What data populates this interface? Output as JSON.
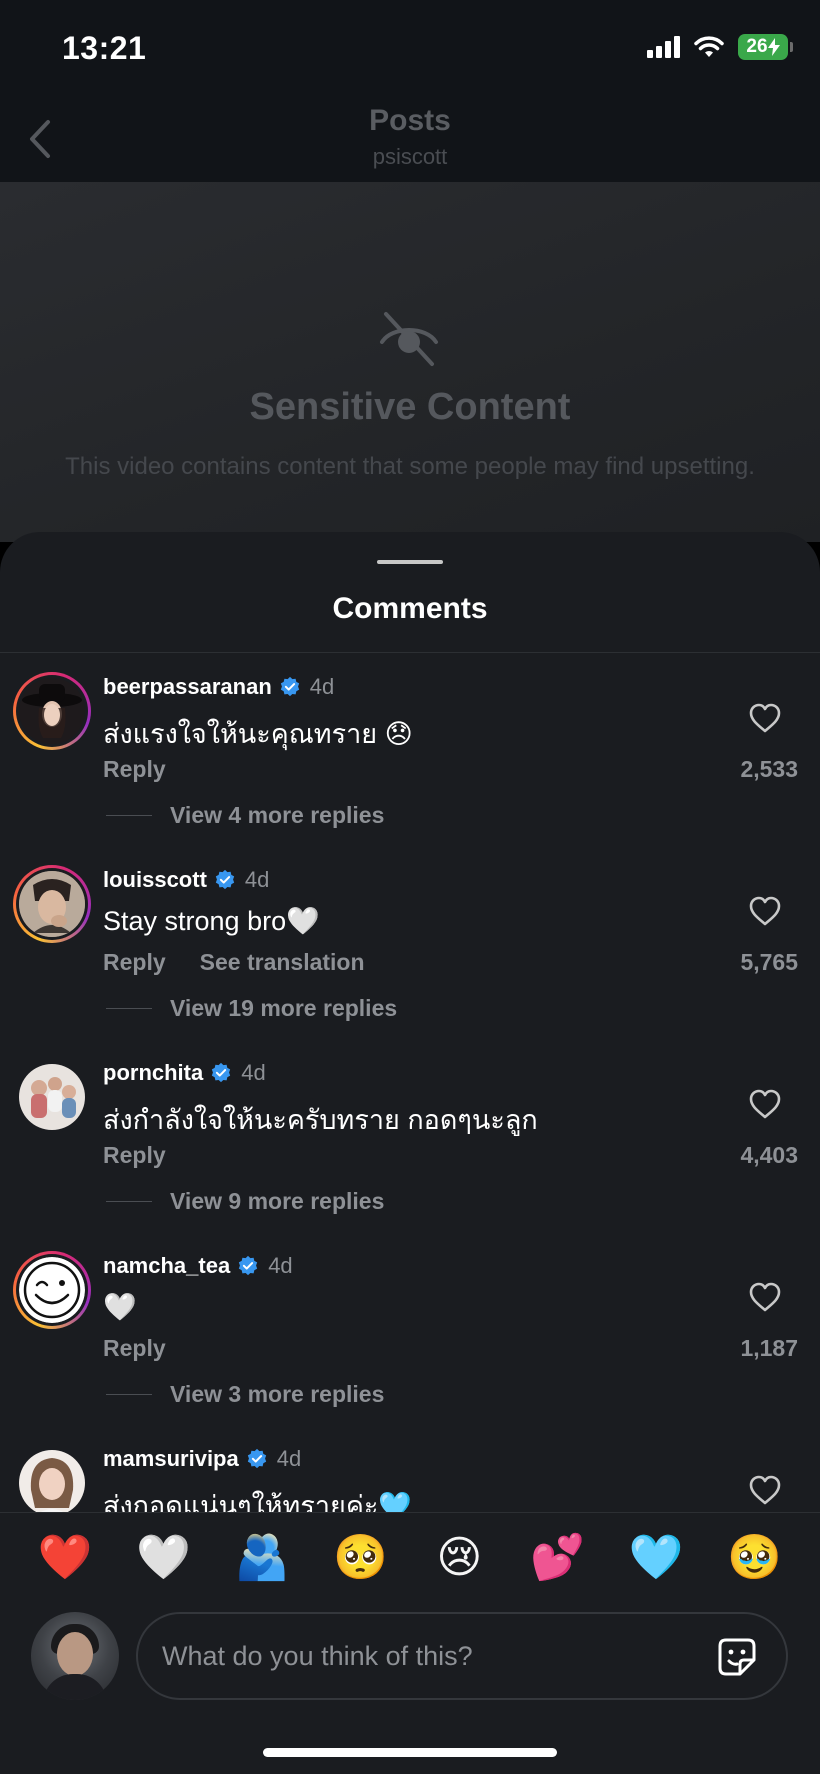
{
  "status_bar": {
    "time": "13:21",
    "battery": "26"
  },
  "header": {
    "title": "Posts",
    "subtitle": "psiscott"
  },
  "sensitive": {
    "title": "Sensitive Content",
    "description": "This video contains content that some people may find upsetting."
  },
  "comments_sheet": {
    "title": "Comments",
    "comments": [
      {
        "username": "beerpassaranan",
        "age": "4d",
        "text": "ส่งแรงใจให้นะคุณทราย 😞",
        "reply": "Reply",
        "translation": "",
        "likes": "2,533",
        "replies": "View 4 more replies"
      },
      {
        "username": "louisscott",
        "age": "4d",
        "text": "Stay strong bro🤍",
        "reply": "Reply",
        "translation": "See translation",
        "likes": "5,765",
        "replies": "View 19 more replies"
      },
      {
        "username": "pornchita",
        "age": "4d",
        "text": "ส่งกำลังใจให้นะครับทราย กอดๆนะลูก",
        "reply": "Reply",
        "translation": "",
        "likes": "4,403",
        "replies": "View 9 more replies"
      },
      {
        "username": "namcha_tea",
        "age": "4d",
        "text": "🤍",
        "reply": "Reply",
        "translation": "",
        "likes": "1,187",
        "replies": "View 3 more replies"
      },
      {
        "username": "mamsurivipa",
        "age": "4d",
        "text": "ส่งกอดแน่นๆให้ทรายค่ะ🩵",
        "reply": "",
        "translation": "",
        "likes": "",
        "replies": ""
      }
    ]
  },
  "emoji_bar": [
    "❤️",
    "🤍",
    "🫂",
    "🥺",
    "😢",
    "💕",
    "🩵",
    "🥹"
  ],
  "composer": {
    "placeholder": "What do you think of this?"
  },
  "colors": {
    "background": "#1a1c20",
    "verified": "#3897f0",
    "muted": "#8e9196"
  }
}
